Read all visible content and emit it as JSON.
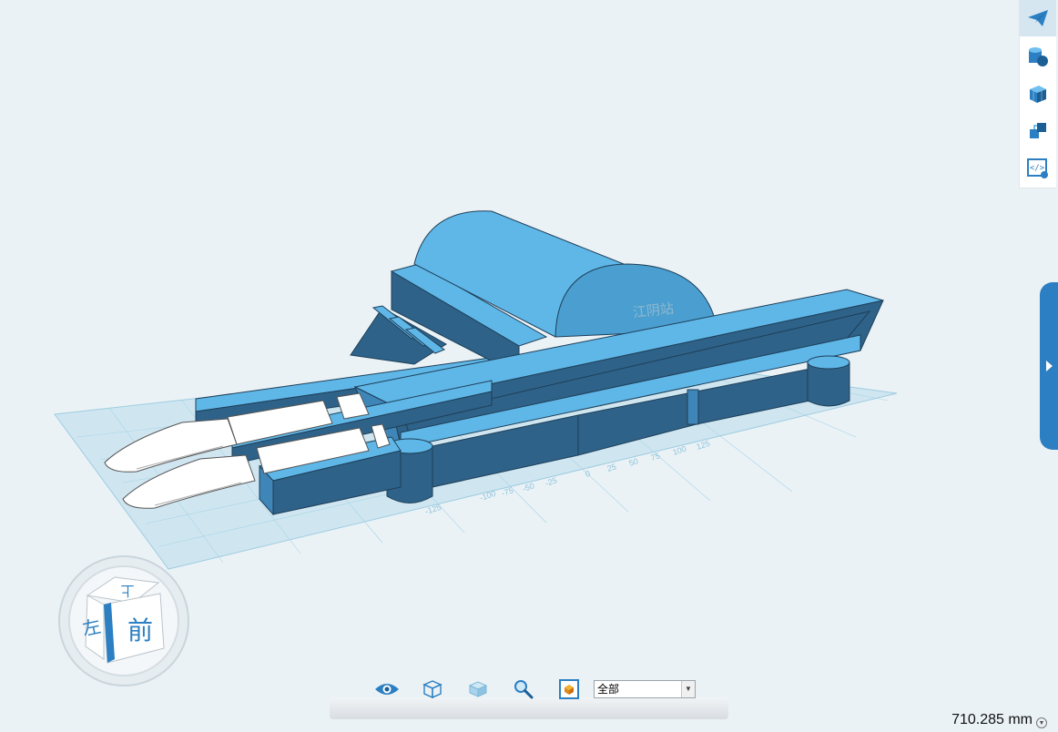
{
  "viewport": {
    "model_label": "江阴站",
    "grid_labels": [
      "-125",
      "-100",
      "-75",
      "-50",
      "-25",
      "0",
      "25",
      "50",
      "75",
      "100",
      "125"
    ]
  },
  "view_cube": {
    "top_face": "上",
    "front_face": "前",
    "left_face": "左"
  },
  "right_toolbar": {
    "tools": [
      "send-icon",
      "shapes-icon",
      "cube-texture-icon",
      "stack-icon",
      "code-icon"
    ]
  },
  "bottom_toolbar": {
    "tools": [
      "eye-icon",
      "wireframe-cube-icon",
      "solid-cube-icon",
      "zoom-icon",
      "fit-view-icon"
    ],
    "filter_value": "全部"
  },
  "status": {
    "dimension": "710.285 mm"
  },
  "colors": {
    "background": "#eaf2f6",
    "model_blue": "#5fb7e8",
    "model_dark": "#2e6288",
    "accent": "#2b7fc2"
  }
}
